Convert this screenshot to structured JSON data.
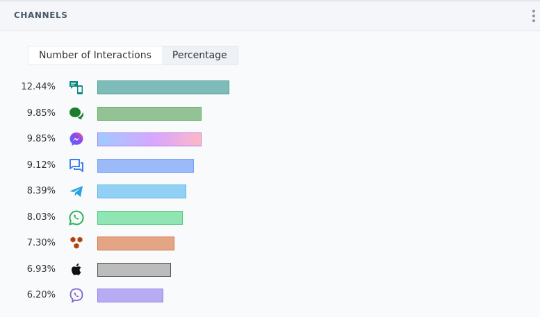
{
  "header": {
    "title": "CHANNELS"
  },
  "toggle": {
    "option_count": "Number of Interactions",
    "option_percent": "Percentage"
  },
  "chart_data": {
    "type": "bar",
    "orientation": "horizontal",
    "unit": "%",
    "categories": [
      "sms",
      "chat",
      "messenger",
      "webchat",
      "telegram",
      "whatsapp",
      "hex-channel",
      "apple",
      "viber"
    ],
    "values": [
      12.44,
      9.85,
      9.85,
      9.12,
      8.39,
      8.03,
      7.3,
      6.93,
      6.2
    ],
    "labels": [
      "12.44%",
      "9.85%",
      "9.85%",
      "9.12%",
      "8.39%",
      "8.03%",
      "7.30%",
      "6.93%",
      "6.20%"
    ],
    "icons": [
      "sms-device-icon",
      "chat-bubbles-icon",
      "messenger-icon",
      "webchat-icon",
      "telegram-icon",
      "whatsapp-icon",
      "hexagon-cluster-icon",
      "apple-icon",
      "viber-icon"
    ],
    "bar_colors": [
      {
        "fill": "#7dbcb8",
        "stroke": "#4f9f98"
      },
      {
        "fill": "#93c295",
        "stroke": "#6aaa6c"
      },
      {
        "fill": "gradient",
        "stroke": "#b57be6",
        "from": "#9ecbff",
        "mid": "#d7a6ff",
        "to": "#ffb7c5"
      },
      {
        "fill": "#9bbaf9",
        "stroke": "#7a9ff0"
      },
      {
        "fill": "#92d1f5",
        "stroke": "#5cb5e6"
      },
      {
        "fill": "#8fe6b3",
        "stroke": "#52c77f"
      },
      {
        "fill": "#e4a584",
        "stroke": "#d0714b"
      },
      {
        "fill": "#bcbcbc",
        "stroke": "#555555"
      },
      {
        "fill": "#b7acf3",
        "stroke": "#9484e6"
      }
    ],
    "icon_colors": [
      "#0c8a80",
      "#1e7d2c",
      "#6a5cf5",
      "#3b7ff0",
      "#2aa3df",
      "#29b35a",
      "#b3410e",
      "#111111",
      "#7d62c9"
    ],
    "max_value": 12.44
  }
}
